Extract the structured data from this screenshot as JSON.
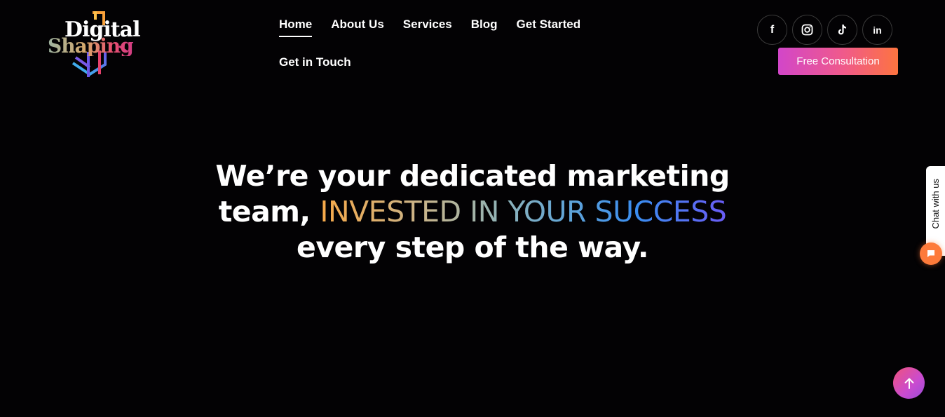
{
  "logo": {
    "word1": "Digital",
    "word2": "Shaping",
    "name": "digital-shaping-logo"
  },
  "nav": {
    "items": [
      {
        "label": "Home",
        "active": true
      },
      {
        "label": "About Us"
      },
      {
        "label": "Services"
      },
      {
        "label": "Blog"
      },
      {
        "label": "Get Started"
      },
      {
        "label": "Get in Touch"
      }
    ]
  },
  "socials": [
    {
      "icon": "facebook-icon",
      "glyph": "f"
    },
    {
      "icon": "instagram-icon",
      "glyph": ""
    },
    {
      "icon": "tiktok-icon",
      "glyph": ""
    },
    {
      "icon": "linkedin-icon",
      "glyph": "in"
    }
  ],
  "cta": {
    "label": "Free Consultation"
  },
  "hero": {
    "line1": "We’re your dedicated marketing",
    "line2_plain": "team, ",
    "line2_highlight": "INVESTED IN YOUR SUCCESS",
    "line3": "every step of the way."
  },
  "chat": {
    "label": "Chat with us",
    "icon": "chat-bubble-icon"
  },
  "scroll_top": {
    "icon": "arrow-up-icon"
  },
  "colors": {
    "background": "#030204",
    "accent_start": "#d246c9",
    "accent_end": "#fd7440",
    "chat_orange": "#fd7a3a"
  }
}
